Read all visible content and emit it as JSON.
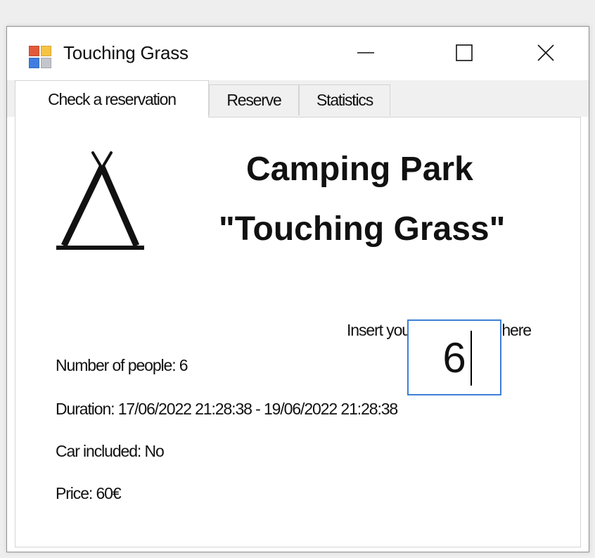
{
  "window": {
    "title": "Touching Grass",
    "icon": "app-icon",
    "controls": {
      "minimize": "minimize-icon",
      "maximize": "maximize-icon",
      "close": "close-icon"
    }
  },
  "tabs": [
    {
      "label": "Check a reservation",
      "active": true
    },
    {
      "label": "Reserve",
      "active": false
    },
    {
      "label": "Statistics",
      "active": false
    }
  ],
  "header": {
    "line1": "Camping Park",
    "line2": "\"Touching Grass\"",
    "logo": "tent-icon"
  },
  "code": {
    "label": "Insert your unique code here",
    "value": "6"
  },
  "reservation": {
    "people": "Number of people: 6",
    "duration": "Duration: 17/06/2022 21:28:38 - 19/06/2022 21:28:38",
    "car": "Car included: No",
    "price": "Price: 60€"
  },
  "colors": {
    "input_border": "#3d7fd6",
    "tab_strip": "#f0f0f0"
  }
}
